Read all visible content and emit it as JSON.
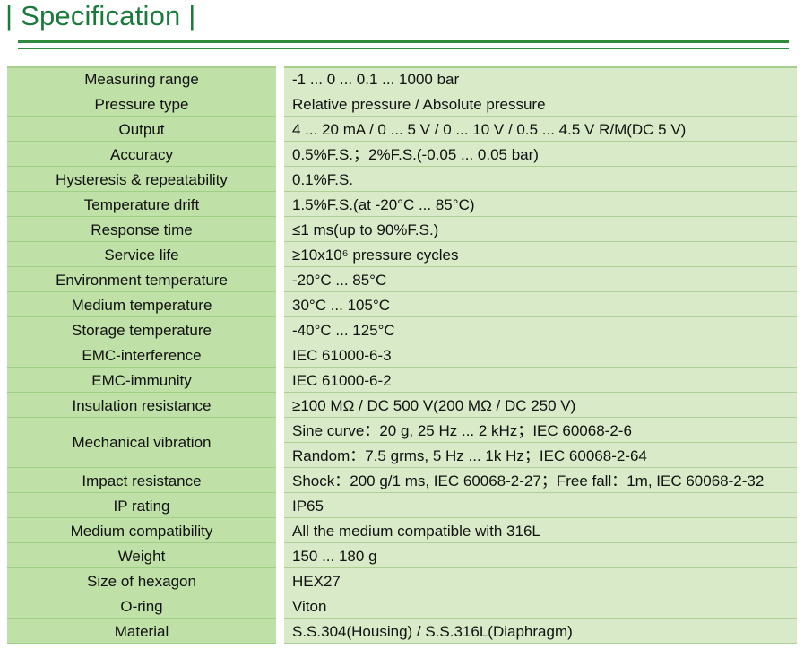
{
  "title": "Specification",
  "rows": [
    {
      "label": "Measuring range",
      "values": [
        "-1 ... 0 ... 0.1 ... 1000 bar"
      ]
    },
    {
      "label": "Pressure type",
      "values": [
        "Relative pressure / Absolute pressure"
      ]
    },
    {
      "label": "Output",
      "values": [
        "4 ... 20 mA / 0 ... 5 V / 0 ... 10 V / 0.5 ... 4.5 V R/M(DC 5 V)"
      ]
    },
    {
      "label": "Accuracy",
      "values": [
        "0.5%F.S.；2%F.S.(-0.05 ... 0.05 bar)"
      ]
    },
    {
      "label": "Hysteresis & repeatability",
      "values": [
        "0.1%F.S."
      ]
    },
    {
      "label": "Temperature drift",
      "values": [
        "1.5%F.S.(at -20°C ... 85°C)"
      ]
    },
    {
      "label": "Response time",
      "values": [
        "≤1 ms(up to 90%F.S.)"
      ]
    },
    {
      "label": "Service life",
      "values": [
        "≥10x10⁶ pressure cycles"
      ]
    },
    {
      "label": "Environment temperature",
      "values": [
        "-20°C ... 85°C"
      ]
    },
    {
      "label": "Medium temperature",
      "values": [
        "30°C ... 105°C"
      ]
    },
    {
      "label": "Storage temperature",
      "values": [
        "-40°C ... 125°C"
      ]
    },
    {
      "label": "EMC-interference",
      "values": [
        "IEC 61000-6-3"
      ]
    },
    {
      "label": "EMC-immunity",
      "values": [
        "IEC 61000-6-2"
      ]
    },
    {
      "label": "Insulation resistance",
      "values": [
        "≥100 MΩ / DC 500 V(200 MΩ / DC 250 V)"
      ]
    },
    {
      "label": "Mechanical vibration",
      "values": [
        "Sine curve：20 g, 25 Hz ... 2 kHz；IEC 60068-2-6",
        "Random：7.5 grms, 5 Hz ... 1k Hz；IEC 60068-2-64"
      ]
    },
    {
      "label": "Impact resistance",
      "values": [
        "Shock：200 g/1 ms, IEC 60068-2-27；Free fall：1m, IEC 60068-2-32"
      ]
    },
    {
      "label": "IP rating",
      "values": [
        "IP65"
      ]
    },
    {
      "label": "Medium compatibility",
      "values": [
        "All the medium compatible with 316L"
      ]
    },
    {
      "label": "Weight",
      "values": [
        "150 ... 180 g"
      ]
    },
    {
      "label": "Size of hexagon",
      "values": [
        "HEX27"
      ]
    },
    {
      "label": "O-ring",
      "values": [
        "Viton"
      ]
    },
    {
      "label": "Material",
      "values": [
        "S.S.304(Housing) / S.S.316L(Diaphragm)"
      ]
    }
  ]
}
